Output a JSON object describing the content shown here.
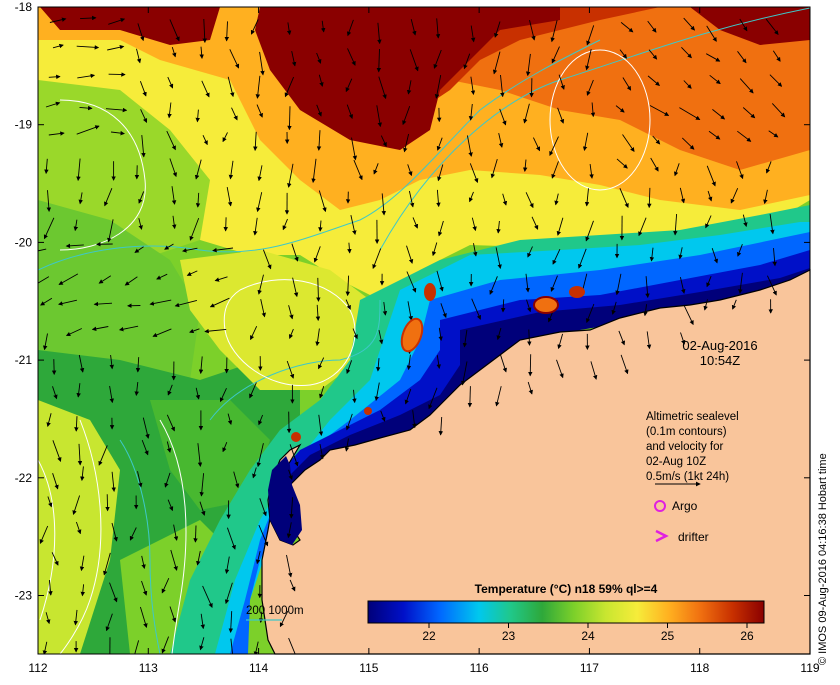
{
  "map": {
    "x_ticks": [
      "112",
      "113",
      "114",
      "115",
      "116",
      "117",
      "118",
      "119"
    ],
    "y_ticks": [
      "-18",
      "-19",
      "-20",
      "-21",
      "-22",
      "-23"
    ],
    "date_label": "02-Aug-2016",
    "time_label": "10:54Z",
    "legend_lines": [
      "Altimetric sealevel",
      "(0.1m contours)",
      "and velocity for",
      "02-Aug 10Z",
      "0.5m/s  (1kt 24h)"
    ],
    "argo_label": "Argo",
    "drifter_label": "drifter",
    "isobath_label": "200  1000m",
    "credit": "© IMOS 09-Aug-2016 04:16:38 Hobart time",
    "colorbar_title": "Temperature (°C) n18 59% ql>=4",
    "colorbar_ticks": [
      "22",
      "23",
      "24",
      "25",
      "26"
    ],
    "colors": {
      "land": "#f9c59b",
      "coast": "#000000",
      "isobath": "#3ec8c8",
      "contour": "#ffffff",
      "argo": "#e020e0",
      "drifter": "#e020e0"
    },
    "colormap": [
      "#00007a",
      "#0010c8",
      "#0066ff",
      "#00c8ee",
      "#20c88a",
      "#2ea83a",
      "#7cd02a",
      "#c8e630",
      "#f6ec3a",
      "#ffb020",
      "#f07010",
      "#c83000",
      "#8a0000"
    ]
  }
}
